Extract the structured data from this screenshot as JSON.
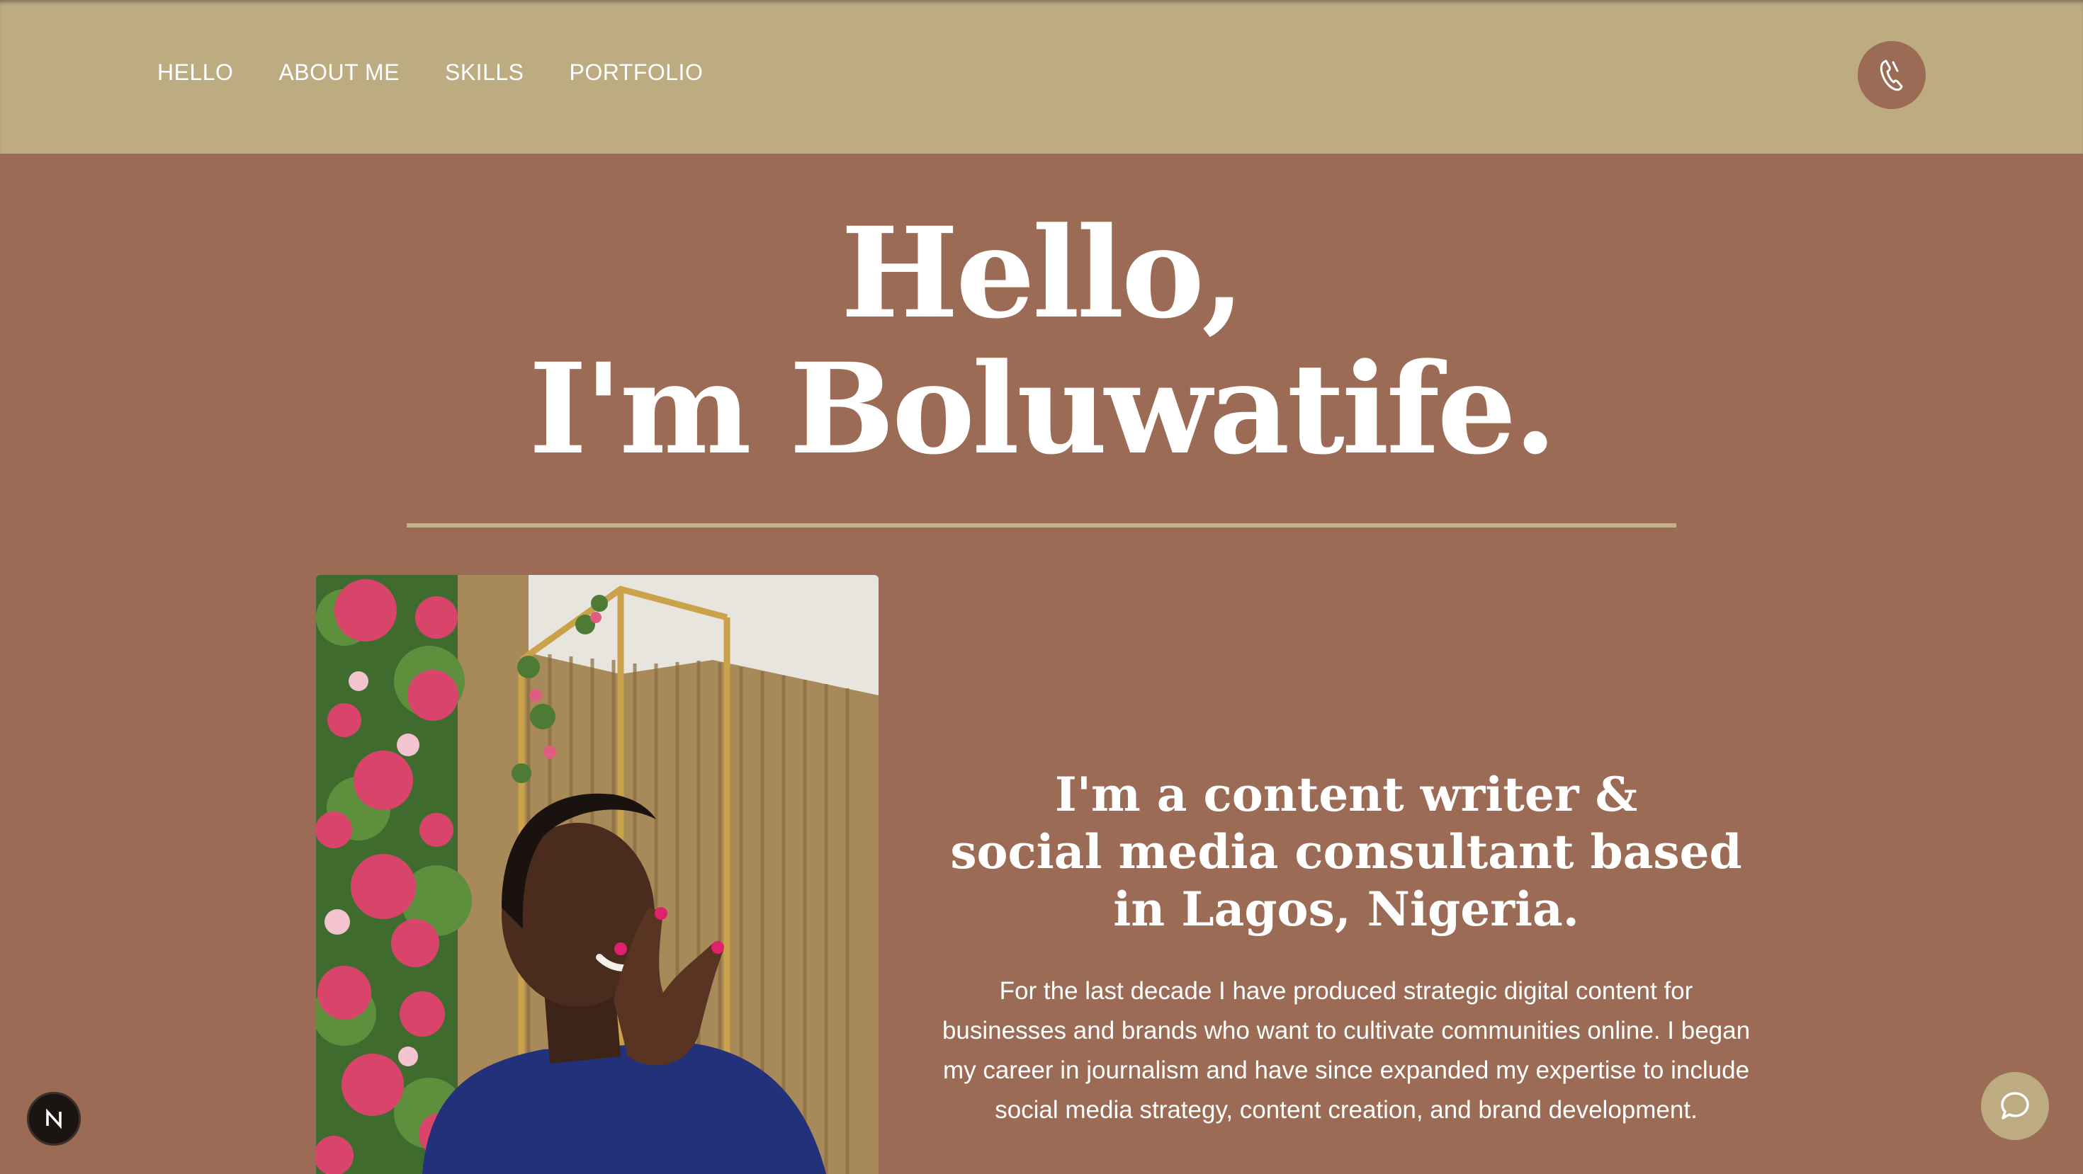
{
  "nav": {
    "items": [
      {
        "label": "HELLO"
      },
      {
        "label": "ABOUT ME"
      },
      {
        "label": "SKILLS"
      },
      {
        "label": "PORTFOLIO"
      }
    ],
    "phone_icon": "phone-icon"
  },
  "hero": {
    "line1": "Hello,",
    "line2": "I'm Boluwatife."
  },
  "about": {
    "subhead_line1": "I'm a content writer &",
    "subhead_line2": "social media consultant based",
    "subhead_line3": "in Lagos, Nigeria.",
    "bio_line1": "For the last decade I have produced strategic digital content for",
    "bio_line2": "businesses and brands who want to cultivate communities online. I began",
    "bio_line3": "my career in journalism and have since expanded my expertise to include",
    "bio_line4": "social media strategy, content creation, and brand development."
  },
  "widgets": {
    "n_badge_icon": "n-logo-icon",
    "chat_icon": "chat-bubble-icon"
  },
  "colors": {
    "header_bg": "#bdac82",
    "page_bg": "#9b6b55",
    "text": "#ffffff"
  }
}
